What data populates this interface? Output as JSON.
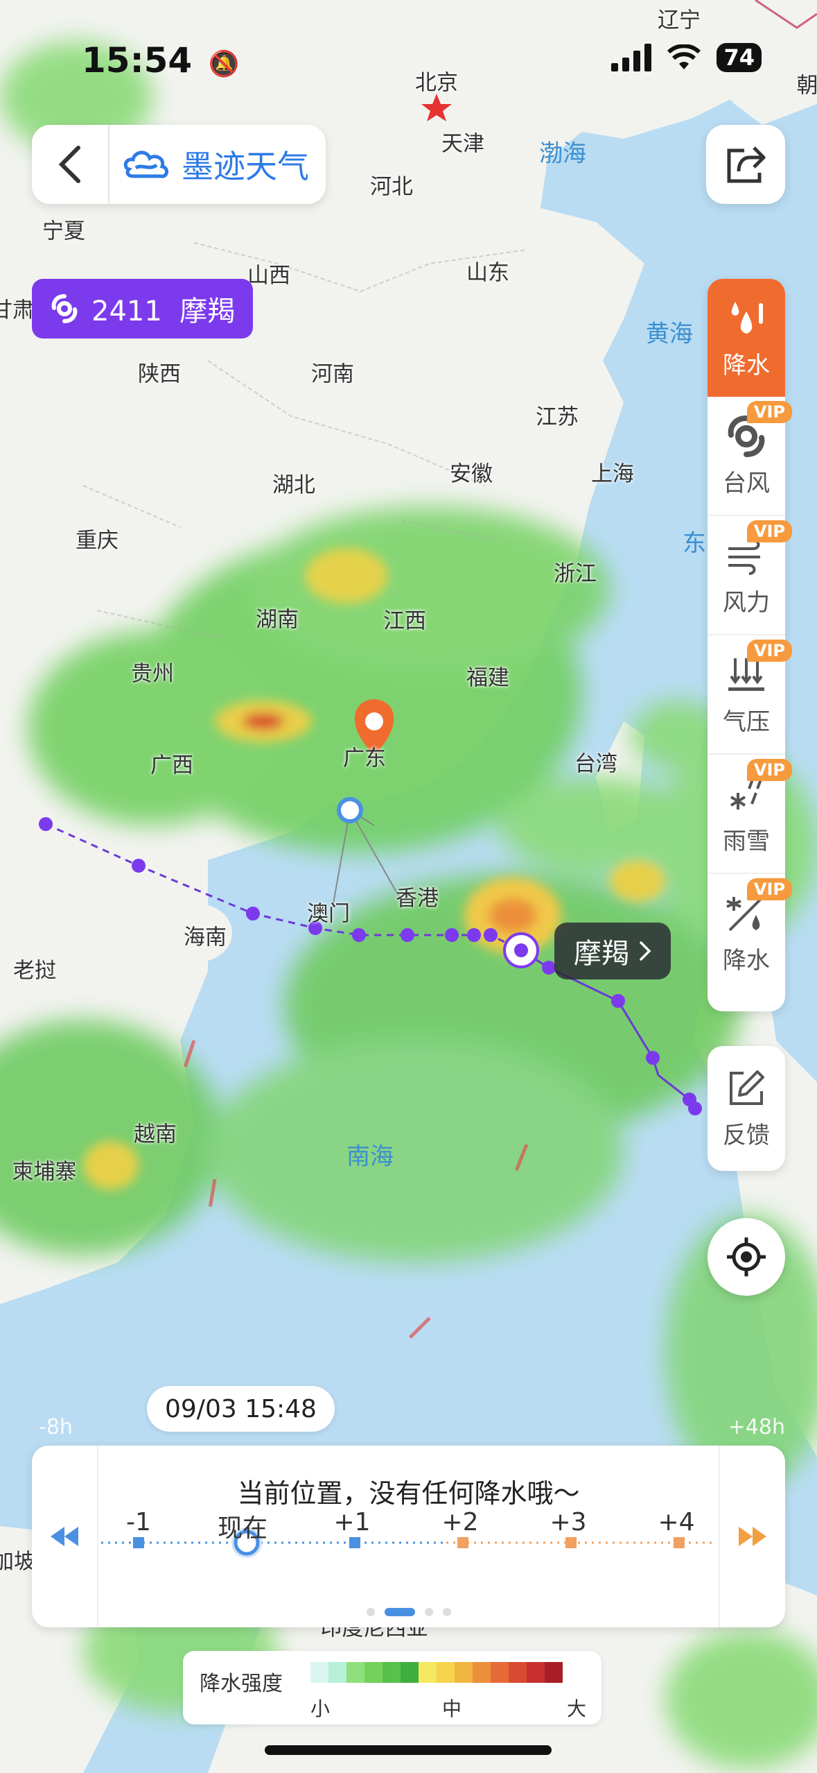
{
  "status_bar": {
    "time": "15:54",
    "battery": "74"
  },
  "header": {
    "brand": "墨迹天气"
  },
  "typhoon_tag": {
    "label": "2411  摩羯"
  },
  "typhoon_callout": {
    "name": "摩羯"
  },
  "layers": [
    {
      "label": "降水",
      "icon": "rain-drops-icon",
      "active": true,
      "vip": ""
    },
    {
      "label": "台风",
      "icon": "typhoon-icon",
      "active": false,
      "vip": "VIP"
    },
    {
      "label": "风力",
      "icon": "wind-icon",
      "active": false,
      "vip": "VIP"
    },
    {
      "label": "气压",
      "icon": "pressure-icon",
      "active": false,
      "vip": "VIP"
    },
    {
      "label": "雨雪",
      "icon": "snow-rain-icon",
      "active": false,
      "vip": "VIP"
    },
    {
      "label": "降水",
      "icon": "precip-type-icon",
      "active": false,
      "vip": "VIP"
    }
  ],
  "feedback": {
    "label": "反馈"
  },
  "map_labels": {
    "liaoning": "辽宁",
    "chao": "朝",
    "beijing": "北京",
    "tianjin": "天津",
    "bohai": "渤海",
    "ningxia": "宁夏",
    "hebei": "河北",
    "shanxi": "山西",
    "shandong": "山东",
    "gansu": "甘肃",
    "huanghai": "黄海",
    "shaanxi": "陕西",
    "henan": "河南",
    "jiangsu": "江苏",
    "hubei": "湖北",
    "anhui": "安徽",
    "shanghai": "上海",
    "chongqing": "重庆",
    "zhejiang": "浙江",
    "dong": "东",
    "hunan": "湖南",
    "jiangxi": "江西",
    "guizhou": "贵州",
    "fujian": "福建",
    "guangxi": "广西",
    "guangdong": "广东",
    "taiwan": "台湾",
    "aomen": "澳门",
    "xianggang": "香港",
    "hainan": "海南",
    "laowo": "老挝",
    "yuenan": "越南",
    "jianpuzhai": "柬埔寨",
    "nanhai": "南海",
    "jiapo": "加坡",
    "indonesia": "印度尼西亚"
  },
  "timeline": {
    "time_bubble": "09/03 15:48",
    "range_start": "-8h",
    "range_end": "+48h",
    "message": "当前位置，没有任何降水哦～",
    "ticks": [
      "-1",
      "现在",
      "+1",
      "+2",
      "+3",
      "+4"
    ]
  },
  "legend": {
    "title": "降水强度",
    "low": "小",
    "mid": "中",
    "high": "大",
    "colors": [
      "#d8f6ef",
      "#b7efd9",
      "#8fe07d",
      "#72d25a",
      "#56c24a",
      "#3fae3f",
      "#f5e860",
      "#f5d34c",
      "#f1b640",
      "#ec8f3a",
      "#e56a36",
      "#d94a32",
      "#c8302e",
      "#a81e26"
    ]
  }
}
